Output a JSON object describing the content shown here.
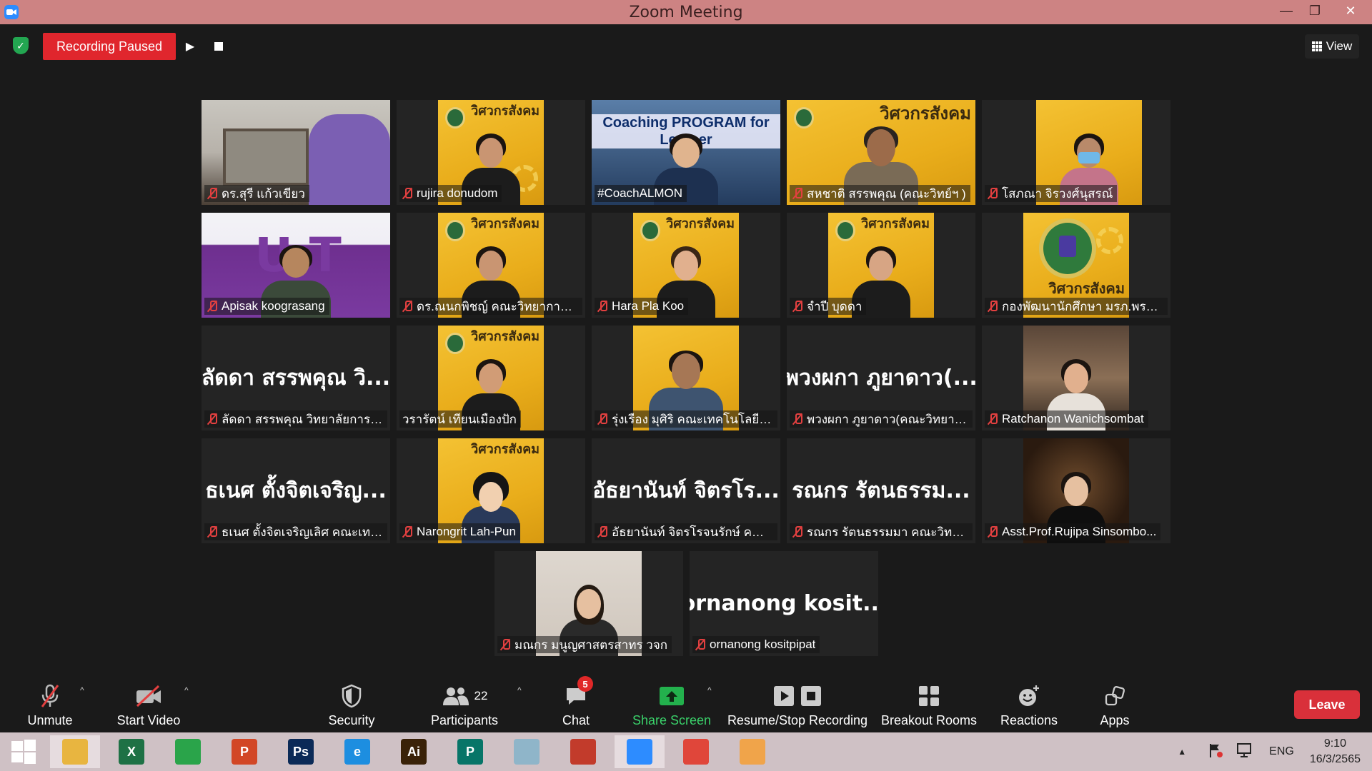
{
  "window": {
    "title": "Zoom Meeting"
  },
  "recording": {
    "status_label": "Recording Paused"
  },
  "view_label": "View",
  "tiles": [
    {
      "name": "ดร.สุรี  แก้วเขียว",
      "muted": true
    },
    {
      "name": "rujira donudom",
      "muted": true,
      "badge_text": "วิศวกรสังคม"
    },
    {
      "name": "#CoachALMON",
      "muted": false,
      "active": true,
      "banner_text": "Coaching PROGRAM for Learner"
    },
    {
      "name": "สหชาติ สรรพคุณ (คณะวิทย์ฯ )",
      "muted": true,
      "badge_text": "วิศวกรสังคม"
    },
    {
      "name": "โสภณา จิรวงศ์นุสรณ์",
      "muted": true
    },
    {
      "name": "Apisak koograsang",
      "muted": true
    },
    {
      "name": "ดร.ณนกพิชญ์ คณะวิทยาการจัด...",
      "muted": true,
      "badge_text": "วิศวกรสังคม"
    },
    {
      "name": "Hara Pla Koo",
      "muted": true,
      "badge_text": "วิศวกรสังคม"
    },
    {
      "name": "จำปี บุดดา",
      "muted": true,
      "badge_text": "วิศวกรสังคม"
    },
    {
      "name": "กองพัฒนานักศึกษา มรภ.พระนคร",
      "muted": true,
      "badge_text": "วิศวกรสังคม"
    },
    {
      "name": "ลัดดา สรรพคุณ วิทยาลัยการฝึ...",
      "muted": true,
      "big_name": "ลัดดา สรรพคุณ วิ..."
    },
    {
      "name": "วรารัตน์ เทียนเมืองปัก",
      "muted": false,
      "badge_text": "วิศวกรสังคม"
    },
    {
      "name": "รุ่งเรือง มุศิริ คณะเทคโนโลยีอุตส...",
      "muted": true
    },
    {
      "name": "พวงผกา ภูยาดาว(คณะวิทยาศา...",
      "muted": true,
      "big_name": "พวงผกา ภูยาดาว(..."
    },
    {
      "name": "Ratchanon Wanichsombat",
      "muted": true
    },
    {
      "name": "ธเนศ ตั้งจิตเจริญเลิศ คณะเทคโน...",
      "muted": true,
      "big_name": "ธเนศ ตั้งจิตเจริญ..."
    },
    {
      "name": "Narongrit Lah-Pun",
      "muted": true,
      "badge_text": "วิศวกรสังคม"
    },
    {
      "name": "อัธยานันท์ จิตรโรจนรักษ์ คณะเท...",
      "muted": true,
      "big_name": "อัธยานันท์ จิตรโร..."
    },
    {
      "name": "รณกร รัตนธรรมมา คณะวิทยาศ...",
      "muted": true,
      "big_name": "รณกร รัตนธรรม..."
    },
    {
      "name": "Asst.Prof.Rujipa Sinsombo...",
      "muted": true
    },
    {
      "name": "มณกร มนูญศาสตรสาทร วจก",
      "muted": true
    },
    {
      "name": "ornanong kositpipat",
      "muted": true,
      "big_name": "ornanong  kosit..."
    }
  ],
  "toolbar": {
    "unmute": "Unmute",
    "start_video": "Start Video",
    "security": "Security",
    "participants": "Participants",
    "participants_count": "22",
    "chat": "Chat",
    "chat_badge": "5",
    "share_screen": "Share Screen",
    "resume_stop_recording": "Resume/Stop Recording",
    "breakout_rooms": "Breakout Rooms",
    "reactions": "Reactions",
    "apps": "Apps",
    "leave": "Leave"
  },
  "taskbar": {
    "apps": [
      {
        "name": "file-explorer-icon",
        "color": "#e8b540",
        "glyph": ""
      },
      {
        "name": "excel-icon",
        "color": "#1e7145",
        "glyph": "X"
      },
      {
        "name": "store-icon",
        "color": "#2aa44a",
        "glyph": ""
      },
      {
        "name": "powerpoint-icon",
        "color": "#d24726",
        "glyph": "P"
      },
      {
        "name": "photoshop-icon",
        "color": "#0b2a57",
        "glyph": "Ps"
      },
      {
        "name": "internet-explorer-icon",
        "color": "#1d8ee0",
        "glyph": "e"
      },
      {
        "name": "illustrator-icon",
        "color": "#3a2208",
        "glyph": "Ai"
      },
      {
        "name": "publisher-icon",
        "color": "#077568",
        "glyph": "P"
      },
      {
        "name": "notepad-icon",
        "color": "#8fb5c9",
        "glyph": ""
      },
      {
        "name": "photoscape-icon",
        "color": "#c23b2b",
        "glyph": ""
      },
      {
        "name": "zoom-icon",
        "color": "#2d8cff",
        "glyph": ""
      },
      {
        "name": "chrome-icon",
        "color": "#e0463a",
        "glyph": ""
      },
      {
        "name": "paint-icon",
        "color": "#f0a44a",
        "glyph": ""
      }
    ],
    "language": "ENG",
    "time": "9:10",
    "date": "16/3/2565"
  }
}
